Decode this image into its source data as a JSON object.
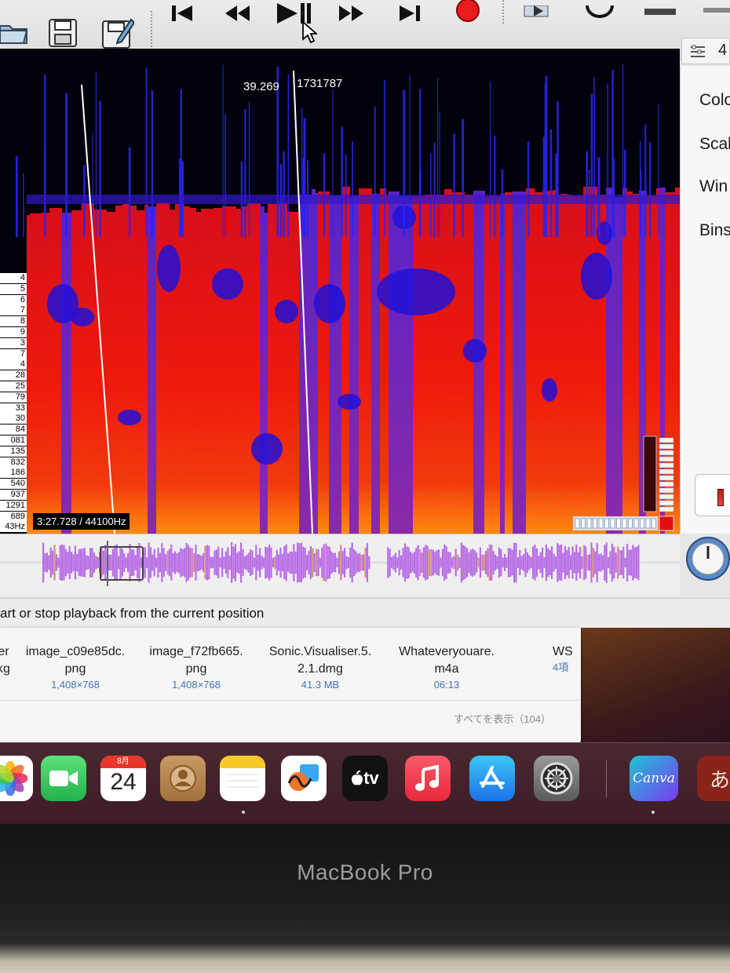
{
  "spectrogram": {
    "scale_labels": [
      "",
      "",
      "",
      "",
      "",
      "",
      "",
      "",
      "",
      "",
      "",
      "",
      "",
      "",
      "",
      "",
      "",
      "",
      "",
      "",
      "",
      "",
      "",
      "",
      "",
      "",
      "",
      "",
      ""
    ],
    "scale_labels_visible": [
      "4",
      "5",
      "6",
      "7",
      "8",
      "9",
      "3",
      "7",
      "4",
      "28",
      "25",
      "79",
      "33",
      "30",
      "84",
      "081",
      "135",
      "832",
      "186",
      "540",
      "937",
      "1291",
      "689",
      "43Hz"
    ],
    "cursor_time": "39.269",
    "cursor_frequency": "1731787",
    "time_rate": "3:27.728 / 44100Hz"
  },
  "properties": {
    "layer_tab_number": "4",
    "labels": [
      "Colo",
      "Scal",
      "Win",
      "Bins"
    ]
  },
  "status_bar": {
    "message": "art or stop playback from the current position"
  },
  "recent_files": {
    "items": [
      {
        "name": "er",
        "ext": "kg",
        "meta": ""
      },
      {
        "name": "image_c09e85dc.",
        "ext": "png",
        "meta": "1,408×768"
      },
      {
        "name": "image_f72fb665.",
        "ext": "png",
        "meta": "1,408×768"
      },
      {
        "name": "Sonic.Visualiser.5.",
        "ext": "2.1.dmg",
        "meta": "41.3 MB"
      },
      {
        "name": "Whateveryouare.",
        "ext": "m4a",
        "meta": "06:13"
      },
      {
        "name": "WS",
        "ext": "",
        "meta": "4項"
      }
    ],
    "show_all": "すべてを表示（104）"
  },
  "dock": {
    "calendar_month": "8月",
    "calendar_day": "24",
    "appletv_label": "tv",
    "canva_label": "Canva",
    "last_app_glyph": "あ"
  },
  "device": {
    "brand": "MacBook Pro"
  },
  "colors": {
    "spectrogram_red": "#e8140c",
    "spectrogram_blue": "#1a10d8",
    "waveform_purple": "#b96ee6",
    "record_red": "#e81c1c"
  }
}
